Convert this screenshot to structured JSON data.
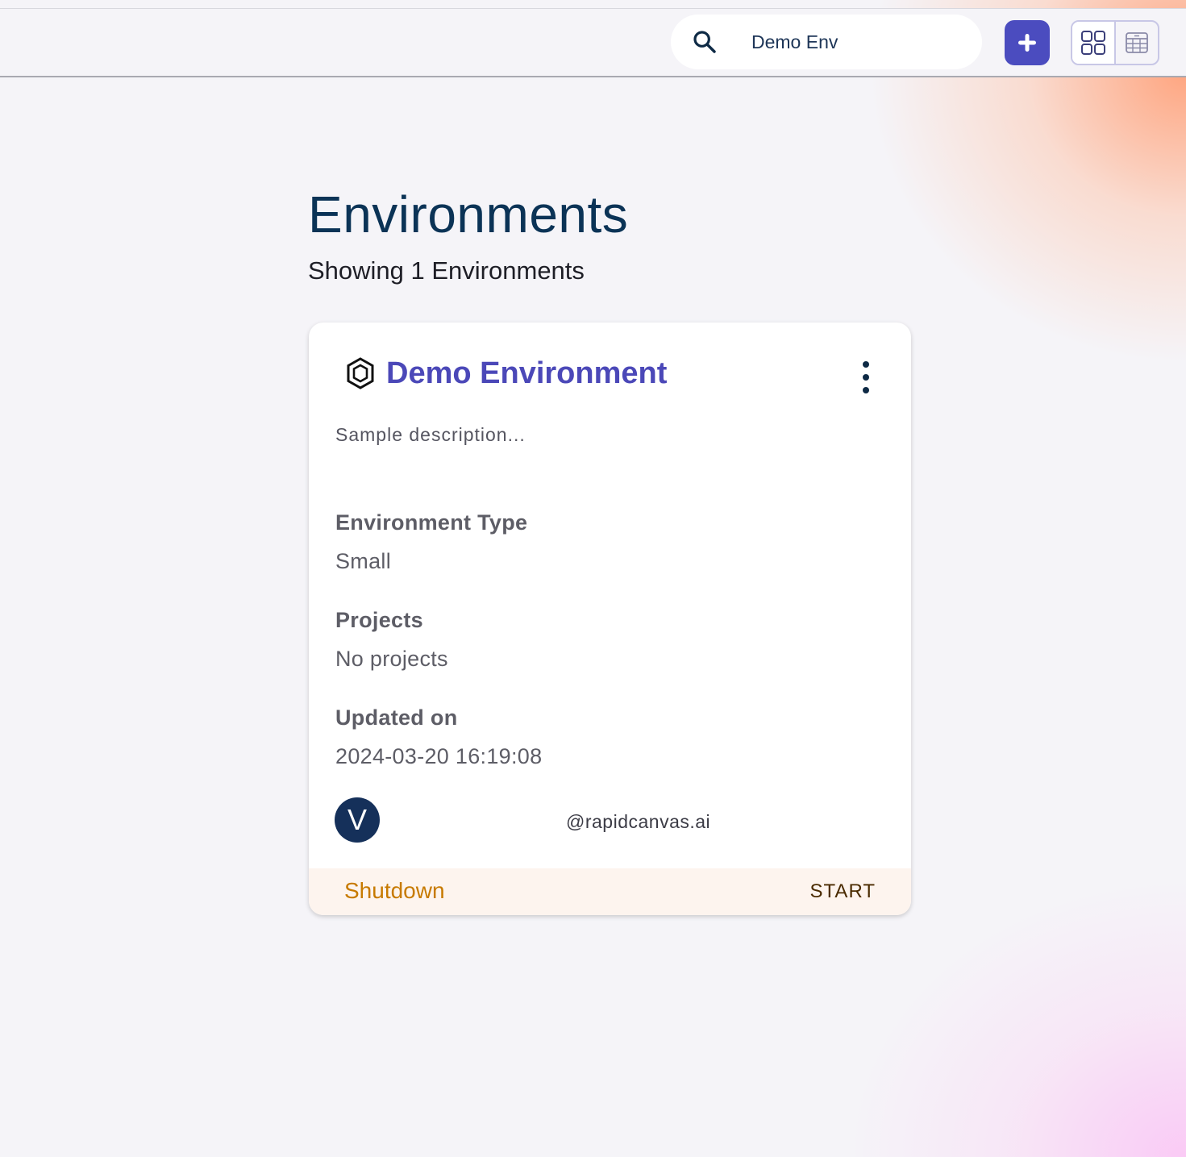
{
  "search": {
    "value": "Demo Env",
    "icon": "search-icon"
  },
  "toolbar": {
    "add_icon": "plus-icon",
    "view_grid_icon": "grid-view-icon",
    "view_table_icon": "table-view-icon",
    "accent": "#4b4cbf"
  },
  "page": {
    "title": "Environments",
    "subtitle": "Showing 1 Environments"
  },
  "card": {
    "icon": "hexagon-icon",
    "title": "Demo Environment",
    "description": "Sample description...",
    "fields": [
      {
        "label": "Environment Type",
        "value": "Small"
      },
      {
        "label": "Projects",
        "value": "No projects"
      },
      {
        "label": "Updated on",
        "value": "2024-03-20 16:19:08"
      }
    ],
    "avatar_letter": "V",
    "owner": "@rapidcanvas.ai",
    "status": "Shutdown",
    "action": "START",
    "status_color": "#c77a00",
    "title_color": "#4b48b8"
  }
}
